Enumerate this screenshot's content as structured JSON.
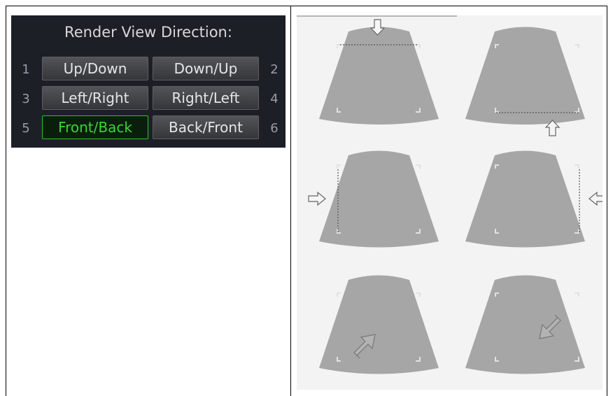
{
  "panel": {
    "title": "Render View Direction:",
    "rows": [
      {
        "left_num": "1",
        "left_label": "Up/Down",
        "right_label": "Down/Up",
        "right_num": "2"
      },
      {
        "left_num": "3",
        "left_label": "Left/Right",
        "right_label": "Right/Left",
        "right_num": "4"
      },
      {
        "left_num": "5",
        "left_label": "Front/Back",
        "right_label": "Back/Front",
        "right_num": "6"
      }
    ],
    "selected": "Front/Back",
    "colors": {
      "background": "#1d1f27",
      "active_border": "#2fc12c",
      "active_text": "#3bd33a"
    }
  },
  "illustrations": [
    {
      "name": "up-down",
      "arrow": "down-arrow-icon"
    },
    {
      "name": "down-up",
      "arrow": "up-arrow-icon"
    },
    {
      "name": "left-right",
      "arrow": "right-arrow-icon"
    },
    {
      "name": "right-left",
      "arrow": "left-arrow-icon"
    },
    {
      "name": "front-back",
      "arrow": "diagonal-up-right-arrow-icon"
    },
    {
      "name": "back-front",
      "arrow": "diagonal-down-left-arrow-icon"
    }
  ],
  "colors": {
    "sector_fill": "#a6a6a6",
    "illustration_background": "#f3f3f3"
  }
}
